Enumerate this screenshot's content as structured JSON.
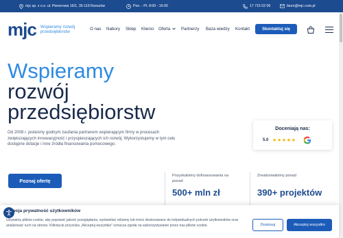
{
  "topbar": {
    "company": "mjc sp. z o.o. ul. Pienerowa 16/1, 35-119 Rzeszów",
    "hours": "Pon. - Pt. 8:00 - 16:00",
    "phone": "17 715 02 06",
    "email": "biuro@mjc.com.pl",
    "icons": [
      "location-pin-icon",
      "clock-icon",
      "phone-icon",
      "mail-icon"
    ]
  },
  "header": {
    "logo_mark": "mjc",
    "logo_tagline": "Wspieramy rozwój przedsiębiorstw",
    "nav": [
      "O nas",
      "Nabory",
      "Sklep",
      "Klienci",
      "Oferta",
      "Partnerzy",
      "Baza wiedzy",
      "Kontakt"
    ],
    "cta": "Skontaktuj się"
  },
  "hero": {
    "title_line1": "Wspieramy",
    "title_line2": "rozwój",
    "title_line3": "przedsiębiorstw",
    "description": "Od 2008 r. jesteśmy godnym zaufania partnerem wspierającym firmy  w procesach zwiększających innowacyjność i przyspieszających ich rozwój. Wykorzystujemy w tym celu dostępne dotacje i inne źródła finansowania pomocowego.",
    "offer_button": "Poznaj ofertę"
  },
  "rating": {
    "label": "Doceniają nas:",
    "score": "5.0",
    "stars": "★★★★★",
    "value": 5.0
  },
  "stats": [
    {
      "caption": "Pozyskaliśmy dofinansowania na ponad",
      "value": "500+ mln zł"
    },
    {
      "caption": "Zrealizowaliśmy ponad",
      "value": "390+ projektów"
    }
  ],
  "cookie": {
    "title": "Twoja prywatność użytkowników",
    "text": "Używamy plików cookie, aby poprawić jakość przeglądania, wyświetlać reklamy lub treści dostosowane do indywidualnych potrzeb użytkowników oraz analizować ruch na stronie. Kliknięcie przycisku „Akceptuj wszystkie” oznacza zgodę na wykorzystywanie przez nas plików cookie.",
    "customize": "Dostosuj",
    "accept_all": "Akceptuj wszystko"
  },
  "colors": {
    "brand_dark": "#1c4b8f",
    "brand_light": "#2f8be0",
    "button": "#1c5cb8"
  }
}
